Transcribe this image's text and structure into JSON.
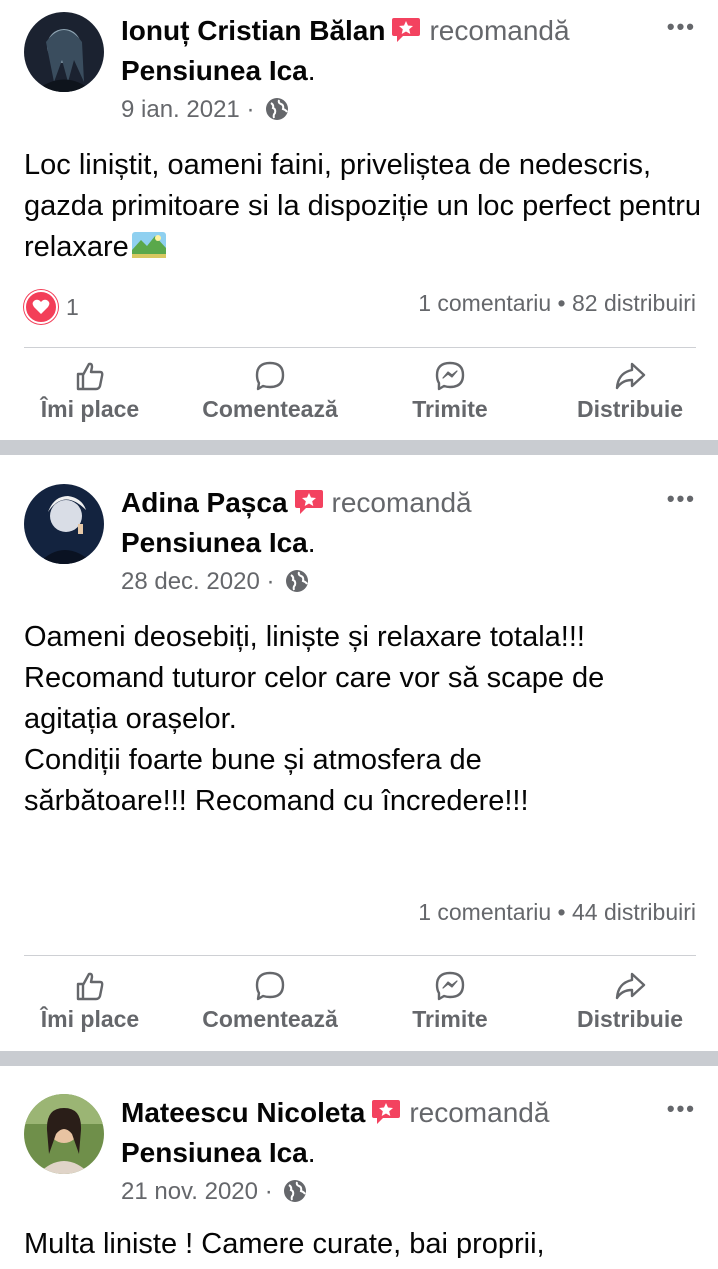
{
  "posts": [
    {
      "author": "Ionuț Cristian Bălan",
      "action": "recomandă",
      "page": "Pensiunea Ica",
      "date": "9 ian. 2021",
      "sep": "·",
      "text": "Loc liniștit, oameni faini, priveliștea de nedescris, gazda primitoare si la dispoziție un loc perfect pentru relaxare",
      "reactions": "1",
      "stats": "1 comentariu • 82 distribuiri"
    },
    {
      "author": "Adina Pașca",
      "action": "recomandă",
      "page": "Pensiunea Ica",
      "date": "28 dec. 2020",
      "sep": "·",
      "text_lines": [
        "Oameni deosebiți, liniște și relaxare totala!!!",
        "Recomand tuturor celor care vor să scape de",
        "agitația orașelor.",
        "Condiții foarte bune și atmosfera de",
        "sărbătoare!!! Recomand cu încredere!!!"
      ],
      "stats": "1 comentariu • 44 distribuiri"
    },
    {
      "author": "Mateescu Nicoleta",
      "action": "recomandă",
      "page": "Pensiunea Ica",
      "date": "21 nov. 2020",
      "sep": "·",
      "text": "Multa liniste ! Camere curate, bai proprii,"
    }
  ],
  "actions": {
    "like": "Îmi place",
    "comment": "Comentează",
    "send": "Trimite",
    "share": "Distribuie"
  },
  "more": "•••",
  "icons": [
    "badge-icon",
    "globe-icon",
    "heart-icon",
    "like-icon",
    "comment-icon",
    "messenger-icon",
    "share-icon",
    "more-icon",
    "landscape-emoji-icon"
  ],
  "colors": {
    "secondary_text": "#65676b",
    "badge": "#f3425f",
    "heart": "#f33e58",
    "separator": "#c9ccd1"
  }
}
